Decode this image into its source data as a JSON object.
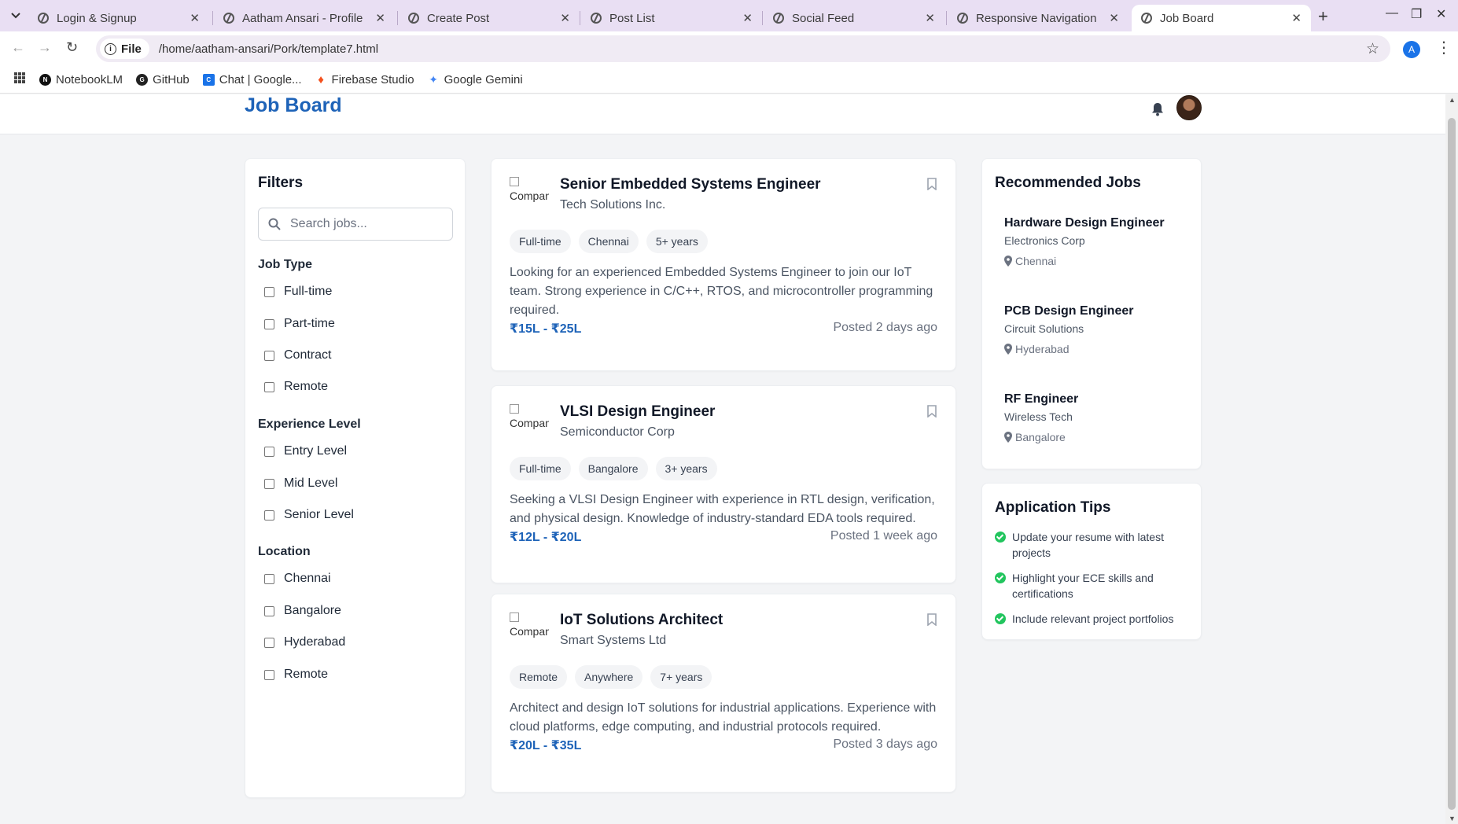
{
  "browser": {
    "tabs": [
      {
        "label": "Login & Signup"
      },
      {
        "label": "Aatham Ansari - Profile"
      },
      {
        "label": "Create Post"
      },
      {
        "label": "Post List"
      },
      {
        "label": "Social Feed"
      },
      {
        "label": "Responsive Navigation"
      },
      {
        "label": "Job Board"
      }
    ],
    "active_tab": "Job Board",
    "address_chip": "File",
    "url": "/home/aatham-ansari/Pork/template7.html",
    "profile_initial": "A",
    "bookmarks": [
      {
        "label": "NotebookLM",
        "icon": "notebooklm-icon"
      },
      {
        "label": "GitHub",
        "icon": "github-icon"
      },
      {
        "label": "Chat | Google...",
        "icon": "google-chat-icon"
      },
      {
        "label": "Firebase Studio",
        "icon": "firebase-icon"
      },
      {
        "label": "Google Gemini",
        "icon": "gemini-icon"
      }
    ]
  },
  "header": {
    "brand": "Job Board"
  },
  "filters": {
    "title": "Filters",
    "search_placeholder": "Search jobs...",
    "job_type": {
      "title": "Job Type",
      "options": [
        "Full-time",
        "Part-time",
        "Contract",
        "Remote"
      ]
    },
    "experience": {
      "title": "Experience Level",
      "options": [
        "Entry Level",
        "Mid Level",
        "Senior Level"
      ]
    },
    "location": {
      "title": "Location",
      "options": [
        "Chennai",
        "Bangalore",
        "Hyderabad",
        "Remote"
      ]
    }
  },
  "jobs": [
    {
      "logo_alt": "Company",
      "title": "Senior Embedded Systems Engineer",
      "company": "Tech Solutions Inc.",
      "tags": [
        "Full-time",
        "Chennai",
        "5+ years"
      ],
      "description": "Looking for an experienced Embedded Systems Engineer to join our IoT team. Strong experience in C/C++, RTOS, and microcontroller programming required.",
      "salary": "₹15L - ₹25L",
      "posted": "Posted 2 days ago"
    },
    {
      "logo_alt": "Company",
      "title": "VLSI Design Engineer",
      "company": "Semiconductor Corp",
      "tags": [
        "Full-time",
        "Bangalore",
        "3+ years"
      ],
      "description": "Seeking a VLSI Design Engineer with experience in RTL design, verification, and physical design. Knowledge of industry-standard EDA tools required.",
      "salary": "₹12L - ₹20L",
      "posted": "Posted 1 week ago"
    },
    {
      "logo_alt": "Company",
      "title": "IoT Solutions Architect",
      "company": "Smart Systems Ltd",
      "tags": [
        "Remote",
        "Anywhere",
        "7+ years"
      ],
      "description": "Architect and design IoT solutions for industrial applications. Experience with cloud platforms, edge computing, and industrial protocols required.",
      "salary": "₹20L - ₹35L",
      "posted": "Posted 3 days ago"
    }
  ],
  "recommended": {
    "title": "Recommended Jobs",
    "items": [
      {
        "title": "Hardware Design Engineer",
        "company": "Electronics Corp",
        "location": "Chennai"
      },
      {
        "title": "PCB Design Engineer",
        "company": "Circuit Solutions",
        "location": "Hyderabad"
      },
      {
        "title": "RF Engineer",
        "company": "Wireless Tech",
        "location": "Bangalore"
      }
    ]
  },
  "tips": {
    "title": "Application Tips",
    "items": [
      "Update your resume with latest projects",
      "Highlight your ECE skills and certifications",
      "Include relevant project portfolios"
    ]
  },
  "colors": {
    "brand": "#1e63b8",
    "tabstrip": "#e9dff3",
    "check": "#22c55e"
  }
}
